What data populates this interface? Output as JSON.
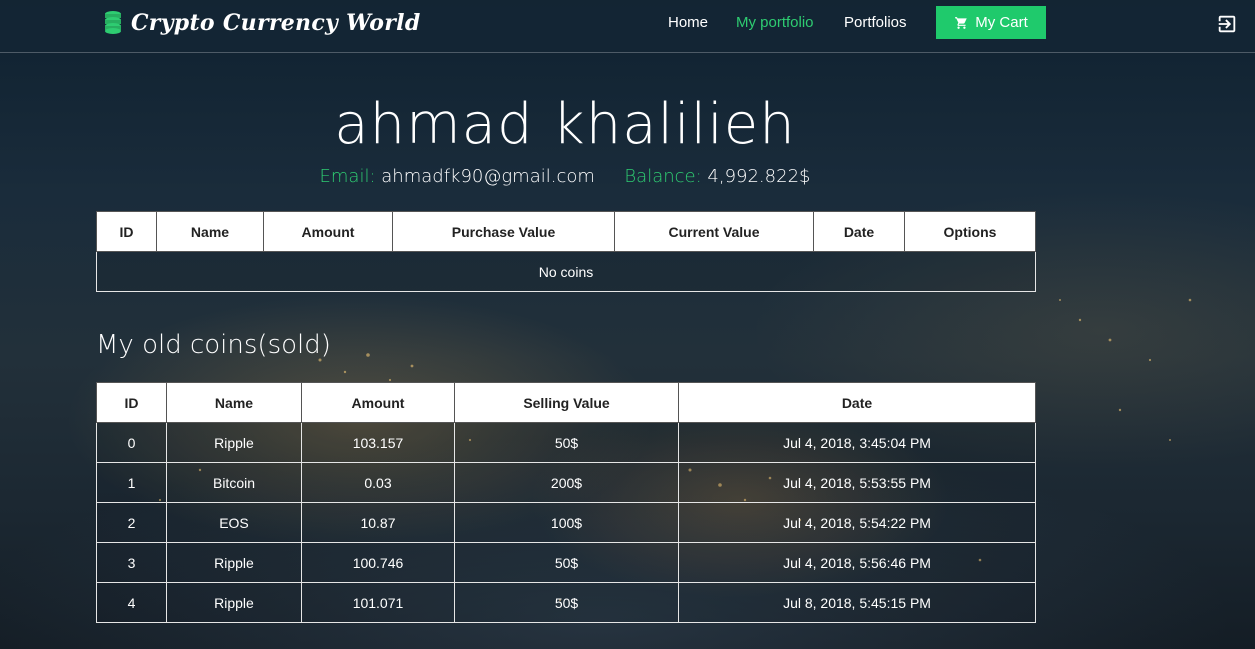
{
  "navbar": {
    "brand": "Crypto Currency World",
    "links": [
      "Home",
      "My portfolio",
      "Portfolios"
    ],
    "active_link": "My portfolio",
    "cart_label": "My Cart",
    "accent_color": "#2ecc71"
  },
  "profile": {
    "name": "ahmad khalilieh",
    "email_label": "Email:",
    "email": "ahmadfk90@gmail.com",
    "balance_label": "Balance:",
    "balance": "4,992.822$"
  },
  "coins_table": {
    "headers": [
      "ID",
      "Name",
      "Amount",
      "Purchase Value",
      "Current Value",
      "Date",
      "Options"
    ],
    "empty_text": "No coins"
  },
  "sold_section": {
    "title": "My old coins(sold)",
    "headers": [
      "ID",
      "Name",
      "Amount",
      "Selling Value",
      "Date"
    ],
    "rows": [
      [
        "0",
        "Ripple",
        "103.157",
        "50$",
        "Jul 4, 2018, 3:45:04 PM"
      ],
      [
        "1",
        "Bitcoin",
        "0.03",
        "200$",
        "Jul 4, 2018, 5:53:55 PM"
      ],
      [
        "2",
        "EOS",
        "10.87",
        "100$",
        "Jul 4, 2018, 5:54:22 PM"
      ],
      [
        "3",
        "Ripple",
        "100.746",
        "50$",
        "Jul 4, 2018, 5:56:46 PM"
      ],
      [
        "4",
        "Ripple",
        "101.071",
        "50$",
        "Jul 8, 2018, 5:45:15 PM"
      ]
    ]
  },
  "icons": {
    "brand": "coin-stack-icon",
    "cart": "shopping-cart-icon",
    "logout": "logout-icon"
  }
}
